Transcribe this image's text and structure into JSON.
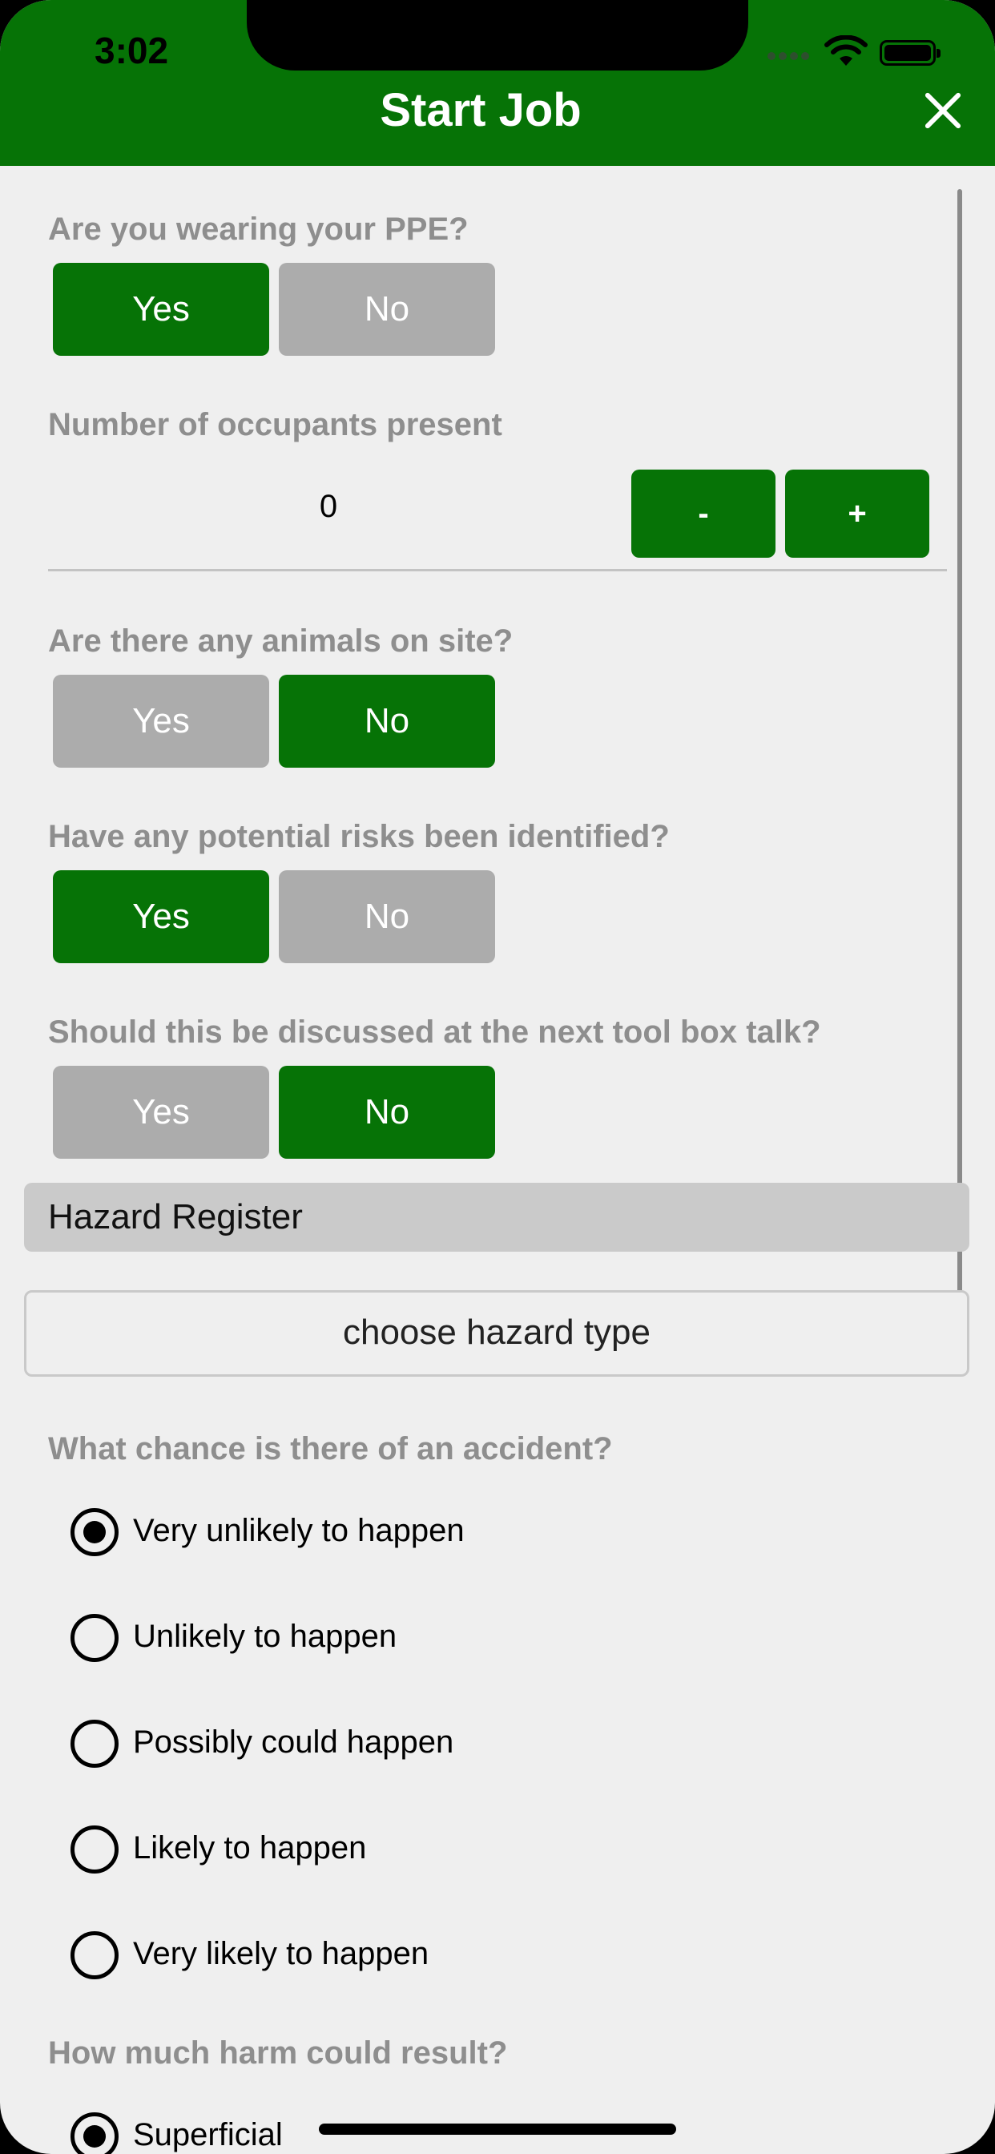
{
  "status_bar": {
    "time": "3:02"
  },
  "header": {
    "title": "Start Job",
    "close_icon": "close-icon"
  },
  "ppe": {
    "label": "Are you wearing your PPE?",
    "yes": "Yes",
    "no": "No",
    "selected": "Yes"
  },
  "occupants": {
    "label": "Number of occupants present",
    "value": "0",
    "minus": "-",
    "plus": "+"
  },
  "animals": {
    "label": "Are there any animals on site?",
    "yes": "Yes",
    "no": "No",
    "selected": "No"
  },
  "risks": {
    "label": "Have any potential risks been identified?",
    "yes": "Yes",
    "no": "No",
    "selected": "Yes"
  },
  "toolbox": {
    "label": "Should this be discussed at the next tool box talk?",
    "yes": "Yes",
    "no": "No",
    "selected": "No"
  },
  "hazard_register": {
    "title": "Hazard Register",
    "choose_button": "choose hazard type"
  },
  "accident_chance": {
    "label": "What chance is there of an accident?",
    "options": [
      "Very unlikely to happen",
      "Unlikely to happen",
      "Possibly could happen",
      "Likely to happen",
      "Very likely to happen"
    ],
    "selected_index": 0
  },
  "harm": {
    "label": "How much harm could result?",
    "options": [
      "Superficial"
    ],
    "selected_index": 0
  },
  "colors": {
    "brand_green": "#067306",
    "inactive_gray": "#acacac",
    "background": "#efefef"
  }
}
